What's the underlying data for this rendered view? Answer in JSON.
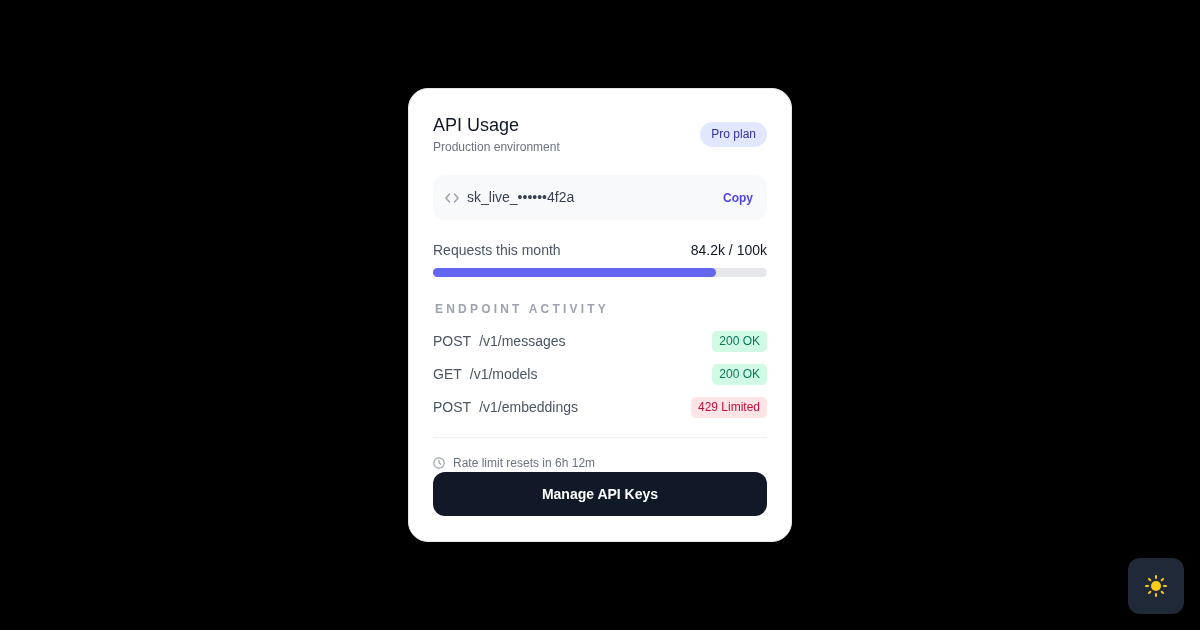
{
  "card": {
    "title": "API Usage",
    "subtitle": "Production environment",
    "plan_badge": "Pro plan"
  },
  "api_key": {
    "value": "sk_live_••••••4f2a",
    "copy_button": "Copy"
  },
  "usage": {
    "label": "Requests this month",
    "reading": "84.2k / 100k",
    "level": 0.847
  },
  "endpoints": {
    "heading": "ENDPOINT ACTIVITY",
    "items": [
      {
        "method": "POST",
        "path": "/v1/messages",
        "status": "200 OK",
        "kind": "ok"
      },
      {
        "method": "GET",
        "path": "/v1/models",
        "status": "200 OK",
        "kind": "ok"
      },
      {
        "method": "POST",
        "path": "/v1/embeddings",
        "status": "429 Limited",
        "kind": "limited"
      }
    ]
  },
  "footer": {
    "reset_note": "Rate limit resets in 6h 12m",
    "button": "Manage API Keys"
  }
}
